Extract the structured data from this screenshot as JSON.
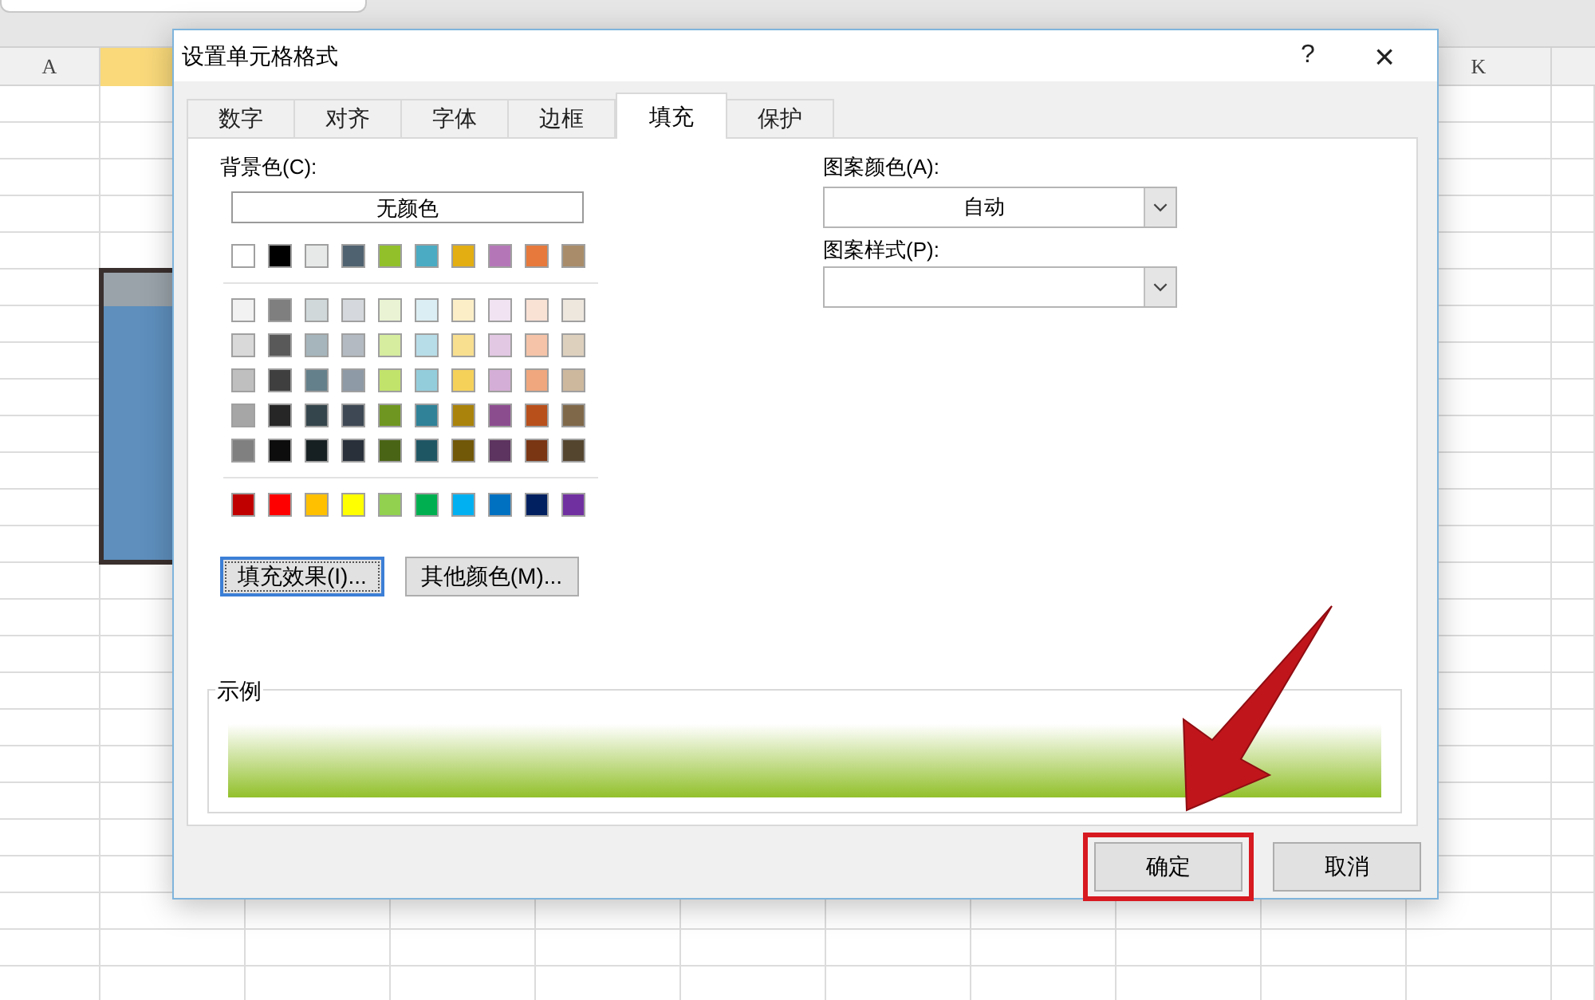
{
  "sheet": {
    "column_headers": [
      {
        "label": "A",
        "selected": false
      },
      {
        "selected": true
      },
      {
        "label": "K",
        "selected": false
      }
    ]
  },
  "dialog": {
    "title": "设置单元格格式",
    "help": "?",
    "close": "×",
    "tabs": [
      {
        "label": "数字",
        "selected": false
      },
      {
        "label": "对齐",
        "selected": false
      },
      {
        "label": "字体",
        "selected": false
      },
      {
        "label": "边框",
        "selected": false
      },
      {
        "label": "填充",
        "selected": true
      },
      {
        "label": "保护",
        "selected": false
      }
    ],
    "background": {
      "label": "背景色(C):",
      "no_color": "无颜色",
      "theme_row": [
        {
          "color": "#ffffff"
        },
        {
          "color": "#000000"
        },
        {
          "color": "#e7e9e9"
        },
        {
          "color": "#4f6270"
        },
        {
          "color": "#92c02b"
        },
        {
          "color": "#4aabc3"
        },
        {
          "color": "#e2ae11"
        },
        {
          "color": "#b576b8"
        },
        {
          "color": "#e6793b"
        },
        {
          "color": "#a98d6a"
        }
      ],
      "shade_rows": [
        [
          {
            "color": "#f2f2f2"
          },
          {
            "color": "#7f7f7f"
          },
          {
            "color": "#d0d8da"
          },
          {
            "color": "#d5d9dd"
          },
          {
            "color": "#eaf4d4"
          },
          {
            "color": "#dbeef3"
          },
          {
            "color": "#fcefc7"
          },
          {
            "color": "#f1e3f1"
          },
          {
            "color": "#f9e1d4"
          },
          {
            "color": "#ede7de"
          }
        ],
        [
          {
            "color": "#d9d9d9"
          },
          {
            "color": "#595959"
          },
          {
            "color": "#a5b5bb"
          },
          {
            "color": "#b3bac2"
          },
          {
            "color": "#d6ec9f"
          },
          {
            "color": "#b7dde8"
          },
          {
            "color": "#f8df90"
          },
          {
            "color": "#e2c8e3"
          },
          {
            "color": "#f4c3a8"
          },
          {
            "color": "#ddd0bd"
          }
        ],
        [
          {
            "color": "#bfbfbf"
          },
          {
            "color": "#3f3f3f"
          },
          {
            "color": "#64808a"
          },
          {
            "color": "#8e9aa6"
          },
          {
            "color": "#c2e36b"
          },
          {
            "color": "#93cddc"
          },
          {
            "color": "#f5d15a"
          },
          {
            "color": "#d4aed6"
          },
          {
            "color": "#f0a77d"
          },
          {
            "color": "#cdb89d"
          }
        ],
        [
          {
            "color": "#a6a6a6"
          },
          {
            "color": "#262626"
          },
          {
            "color": "#34454b"
          },
          {
            "color": "#3d4854"
          },
          {
            "color": "#6f9620"
          },
          {
            "color": "#2f8297"
          },
          {
            "color": "#a9830b"
          },
          {
            "color": "#8c4d8f"
          },
          {
            "color": "#b8501c"
          },
          {
            "color": "#7f6849"
          }
        ],
        [
          {
            "color": "#808080"
          },
          {
            "color": "#0d0d0d"
          },
          {
            "color": "#161f22"
          },
          {
            "color": "#29303a"
          },
          {
            "color": "#4a6415"
          },
          {
            "color": "#1f5664"
          },
          {
            "color": "#715708"
          },
          {
            "color": "#5d335f"
          },
          {
            "color": "#7a3513"
          },
          {
            "color": "#54452f"
          }
        ]
      ],
      "standard_row": [
        {
          "color": "#c00000"
        },
        {
          "color": "#ff0000"
        },
        {
          "color": "#ffc000"
        },
        {
          "color": "#ffff00"
        },
        {
          "color": "#92d050"
        },
        {
          "color": "#00b050"
        },
        {
          "color": "#00b0f0"
        },
        {
          "color": "#0070c0"
        },
        {
          "color": "#002060"
        },
        {
          "color": "#7030a0"
        }
      ],
      "buttons": [
        {
          "label": "填充效果(I)...",
          "focused": true
        },
        {
          "label": "其他颜色(M)...",
          "focused": false
        }
      ]
    },
    "pattern_color": {
      "label": "图案颜色(A):",
      "value": "自动"
    },
    "pattern_style": {
      "label": "图案样式(P):"
    },
    "sample": {
      "label": "示例",
      "color": "#92c02b"
    },
    "footer_buttons": [
      {
        "label": "确定",
        "highlighted": true
      },
      {
        "label": "取消",
        "highlighted": false
      }
    ]
  }
}
